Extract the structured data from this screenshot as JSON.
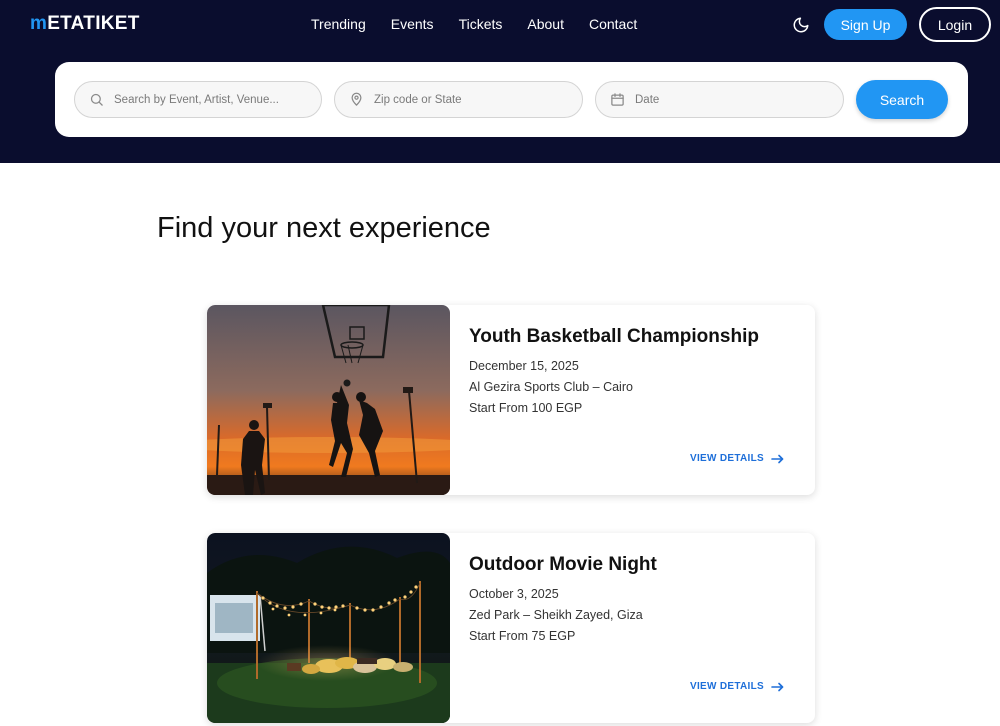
{
  "brand": {
    "logo_first": "m",
    "logo_rest": "ETATIKET"
  },
  "nav": {
    "items": [
      {
        "label": "Trending"
      },
      {
        "label": "Events"
      },
      {
        "label": "Tickets"
      },
      {
        "label": "About"
      },
      {
        "label": "Contact"
      }
    ]
  },
  "header": {
    "theme_icon": "moon-icon",
    "signup_label": "Sign Up",
    "login_label": "Login"
  },
  "search": {
    "event_placeholder": "Search by Event, Artist, Venue...",
    "location_placeholder": "Zip code or State",
    "date_placeholder": "Date",
    "button_label": "Search"
  },
  "main": {
    "heading": "Find your next experience",
    "events": [
      {
        "title": "Youth Basketball Championship",
        "date": "December 15, 2025",
        "venue": "Al Gezira Sports Club – Cairo",
        "price": "Start From 100 EGP",
        "details_label": "VIEW DETAILS"
      },
      {
        "title": "Outdoor Movie Night",
        "date": "October 3, 2025",
        "venue": "Zed Park – Sheikh Zayed, Giza",
        "price": "Start From 75 EGP",
        "details_label": "VIEW DETAILS"
      }
    ]
  },
  "colors": {
    "header_bg": "#0a0d2e",
    "accent": "#2196f3",
    "link": "#1e6fd9"
  }
}
